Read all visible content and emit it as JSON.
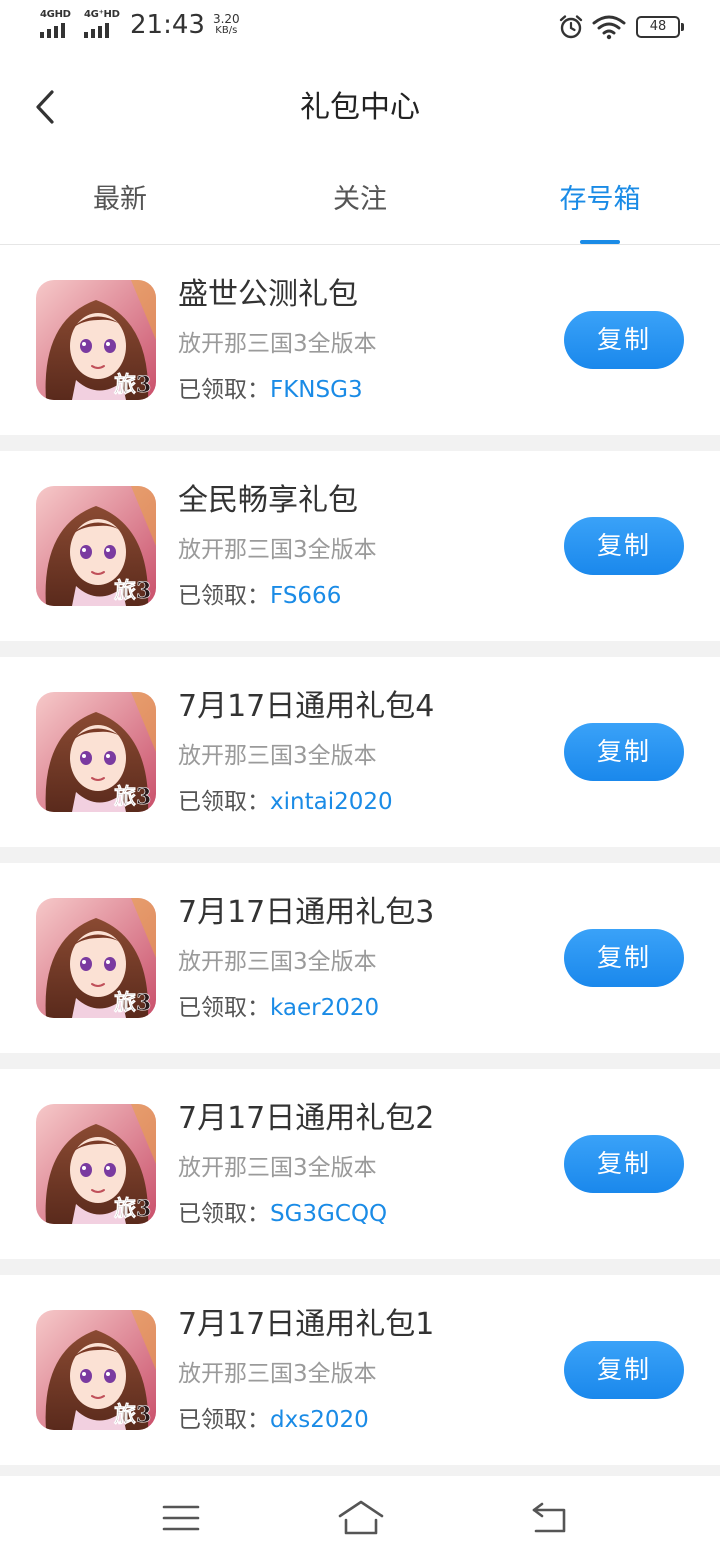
{
  "status_bar": {
    "signal1_label": "4GHD",
    "signal2_label": "4G⁺HD",
    "time": "21:43",
    "speed_value": "3.20",
    "speed_unit": "KB/s",
    "battery": "48"
  },
  "header": {
    "title": "礼包中心"
  },
  "tabs": [
    {
      "label": "最新",
      "active": false
    },
    {
      "label": "关注",
      "active": false
    },
    {
      "label": "存号箱",
      "active": true
    }
  ],
  "gifts": [
    {
      "title": "盛世公测礼包",
      "game": "放开那三国3全版本",
      "code_label": "已领取：",
      "code": "FKNSG3",
      "button": "复制",
      "icon": "game-thumbnail"
    },
    {
      "title": "全民畅享礼包",
      "game": "放开那三国3全版本",
      "code_label": "已领取：",
      "code": "FS666",
      "button": "复制",
      "icon": "game-thumbnail"
    },
    {
      "title": "7月17日通用礼包4",
      "game": "放开那三国3全版本",
      "code_label": "已领取：",
      "code": "xintai2020",
      "button": "复制",
      "icon": "game-thumbnail"
    },
    {
      "title": "7月17日通用礼包3",
      "game": "放开那三国3全版本",
      "code_label": "已领取：",
      "code": "kaer2020",
      "button": "复制",
      "icon": "game-thumbnail"
    },
    {
      "title": "7月17日通用礼包2",
      "game": "放开那三国3全版本",
      "code_label": "已领取：",
      "code": "SG3GCQQ",
      "button": "复制",
      "icon": "game-thumbnail"
    },
    {
      "title": "7月17日通用礼包1",
      "game": "放开那三国3全版本",
      "code_label": "已领取：",
      "code": "dxs2020",
      "button": "复制",
      "icon": "game-thumbnail"
    }
  ],
  "nav": {
    "menu_icon": "menu-icon",
    "home_icon": "home-icon",
    "back_icon": "return-icon"
  },
  "colors": {
    "accent": "#1a8be6",
    "background": "#f2f2f2",
    "title_text": "#333333",
    "sub_text": "#9a9a9a"
  }
}
